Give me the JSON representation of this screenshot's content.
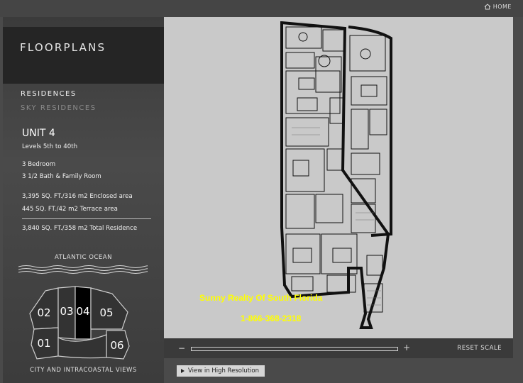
{
  "nav": {
    "home_label": "HOME"
  },
  "sidebar": {
    "title": "FLOORPLANS",
    "items": [
      {
        "label": "RESIDENCES"
      },
      {
        "label": "SKY RESIDENCES"
      }
    ]
  },
  "unit": {
    "name": "UNIT 4",
    "levels": "Levels 5th to 40th",
    "bedrooms": "3 Bedroom",
    "baths": "3 1/2 Bath & Family Room",
    "enclosed_area": "3,395 SQ. FT./316 m2 Enclosed area",
    "terrace_area": "445 SQ. FT./42 m2 Terrace area",
    "total_area": "3,840 SQ. FT./358 m2 Total Residence"
  },
  "keyplan": {
    "top_label": "ATLANTIC OCEAN",
    "bottom_label": "CITY AND INTRACOASTAL VIEWS",
    "units": [
      "02",
      "03",
      "04",
      "05",
      "01",
      "06"
    ],
    "selected": "04"
  },
  "viewer": {
    "watermark_name": "Sunny Realty Of South Florida",
    "watermark_phone": "1-866-368-2318"
  },
  "zoom": {
    "minus": "−",
    "plus": "+",
    "reset_label": "RESET SCALE"
  },
  "hires": {
    "label": "View in High Resolution"
  },
  "colors": {
    "watermark": "#ffff00",
    "viewer_bg": "#c9c9c9",
    "panel_dark": "#252525"
  }
}
